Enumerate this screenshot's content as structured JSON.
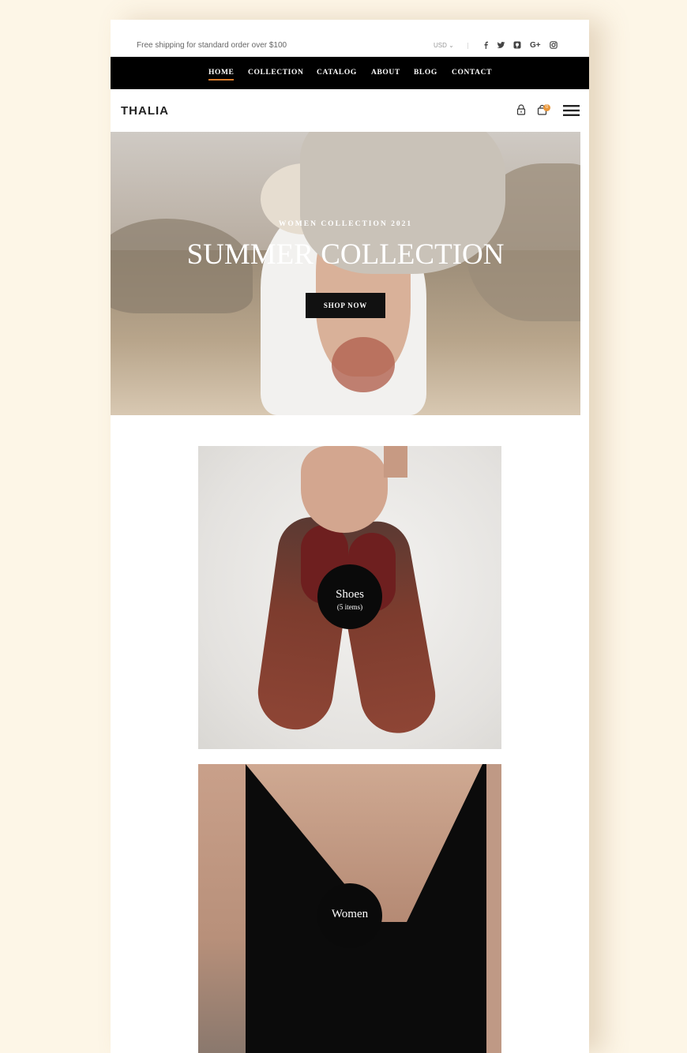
{
  "topbar": {
    "shipping_text": "Free shipping for standard order over $100",
    "currency": "USD",
    "social_icons": [
      "facebook-icon",
      "twitter-icon",
      "pinterest-icon",
      "google-plus-icon",
      "instagram-icon"
    ]
  },
  "nav": {
    "items": [
      {
        "label": "HOME",
        "active": true
      },
      {
        "label": "COLLECTION"
      },
      {
        "label": "CATALOG"
      },
      {
        "label": "ABOUT"
      },
      {
        "label": "BLOG"
      },
      {
        "label": "CONTACT"
      }
    ]
  },
  "header": {
    "logo": "THALIA",
    "cart_count": "0",
    "icons": [
      "lock-icon",
      "cart-icon",
      "menu-icon"
    ]
  },
  "hero": {
    "subtitle": "WOMEN COLLECTION 2021",
    "title": "SUMMER COLLECTION",
    "button": "SHOP NOW"
  },
  "categories": [
    {
      "name": "Shoes",
      "count": "(5 items)"
    },
    {
      "name": "Women",
      "count": ""
    }
  ],
  "colors": {
    "page_bg": "#fdf6e7",
    "nav_bg": "#000000",
    "accent": "#d97a2a",
    "badge": "#e8963a"
  }
}
